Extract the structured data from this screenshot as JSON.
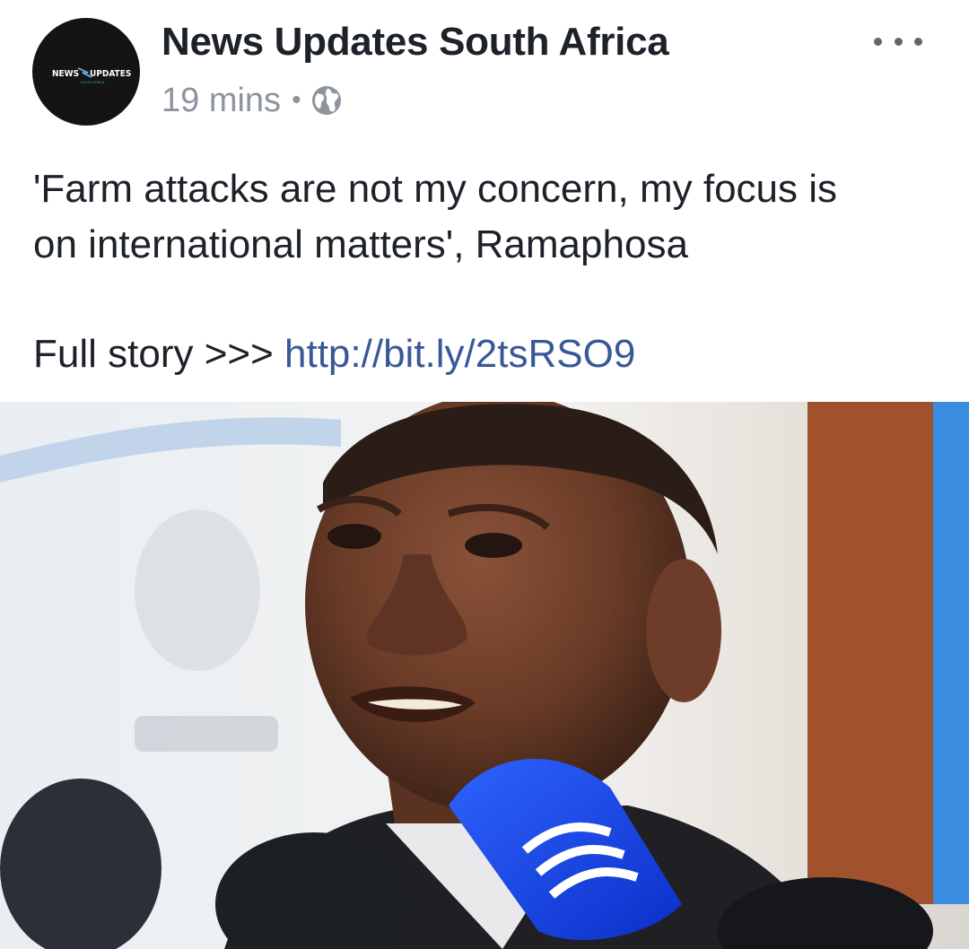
{
  "post": {
    "page_name": "News Updates South Africa",
    "time": "19 mins",
    "separator": "•",
    "privacy_icon": "globe-icon",
    "menu_icon": "more-options-icon",
    "avatar": {
      "logo_text_left": "NEWS",
      "logo_text_right": "UPDATES",
      "logo_subtext": "SOUTH AFRICA",
      "background": "#141414"
    },
    "message_line1": "'Farm attacks are not my concern, my focus is",
    "message_line2": "on international matters', Ramaphosa",
    "full_story_label": "Full story >>>",
    "link": "http://bit.ly/2tsRSO9",
    "link_color": "#385898",
    "image": "news-photo"
  }
}
